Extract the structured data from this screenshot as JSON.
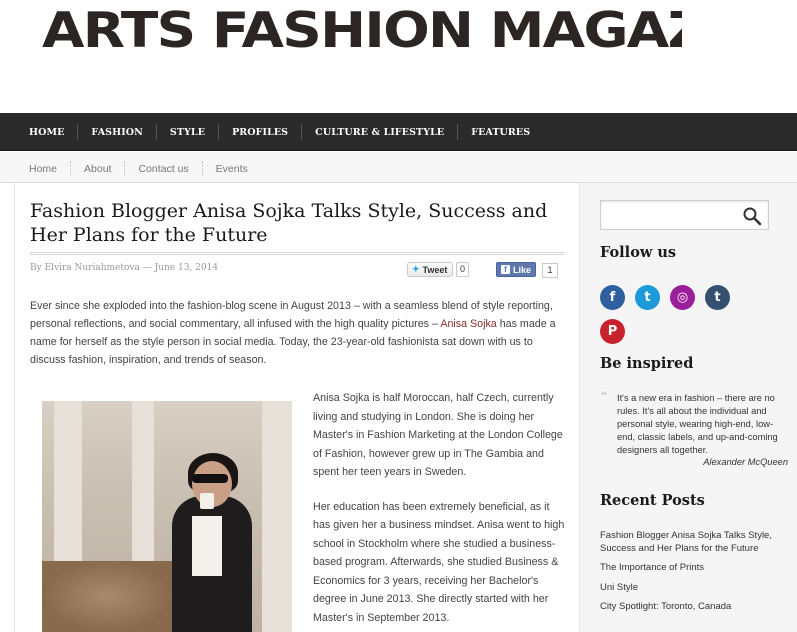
{
  "site": {
    "logo_text": "ARTS FASHION MAGAZINE"
  },
  "main_nav": {
    "items": [
      "HOME",
      "FASHION",
      "STYLE",
      "PROFILES",
      "CULTURE & LIFESTYLE",
      "FEATURES"
    ]
  },
  "sub_nav": {
    "items": [
      "Home",
      "About",
      "Contact us",
      "Events"
    ]
  },
  "article": {
    "title": "Fashion Blogger Anisa Sojka Talks Style, Success and Her Plans for the Future",
    "byline": "By Elvira Nuriahmetova — June 13, 2014",
    "tweet_label": "Tweet",
    "tweet_count": "0",
    "like_label": "Like",
    "like_count": "1",
    "intro_before": "Ever since she exploded into the fashion-blog scene in August 2013 – with a seamless blend of style reporting, personal reflections, and social commentary, all infused with the high quality pictures – ",
    "intro_name": "Anisa Sojka",
    "intro_after": " has made a name for herself as the style person in social media. Today, the 23-year-old fashionista sat down with us to discuss fashion, inspiration, and trends of season.",
    "para1": "Anisa Sojka is half Moroccan, half Czech, currently living and studying in London. She is doing her Master's in Fashion Marketing at the London College of Fashion, however grew up in The Gambia and spent her teen years in Sweden.",
    "para2": "Her education has been extremely beneficial, as it has given her a business mindset. Anisa went to high school in Stockholm where she studied a business-based program. Afterwards, she studied Business & Economics for 3 years, receiving her Bachelor's degree in June 2013. She directly started with her Master's in September 2013."
  },
  "sidebar": {
    "search": {
      "placeholder": "",
      "value": ""
    },
    "follow_heading": "Follow us",
    "social": [
      {
        "name": "facebook",
        "glyph": "f",
        "color": "#2f5f9e"
      },
      {
        "name": "twitter",
        "glyph": "t",
        "color": "#1d9bd8"
      },
      {
        "name": "instagram",
        "glyph": "◎",
        "color": "#9b1f9a"
      },
      {
        "name": "tumblr",
        "glyph": "t",
        "color": "#34506e"
      },
      {
        "name": "pinterest",
        "glyph": "P",
        "color": "#c8232c"
      }
    ],
    "inspired_heading": "Be inspired",
    "quote_mark": "“",
    "quote_text": "It's a new era in fashion – there are no rules. It's all about the individual and personal style, wearing high-end, low-end, classic labels, and up-and-coming designers all together.",
    "quote_author": "Alexander McQueen",
    "recent_heading": "Recent Posts",
    "recent_posts": [
      "Fashion Blogger Anisa Sojka Talks Style, Success and Her Plans for the Future",
      "The Importance of Prints",
      "Uni Style",
      "City Spotlight: Toronto, Canada"
    ]
  }
}
